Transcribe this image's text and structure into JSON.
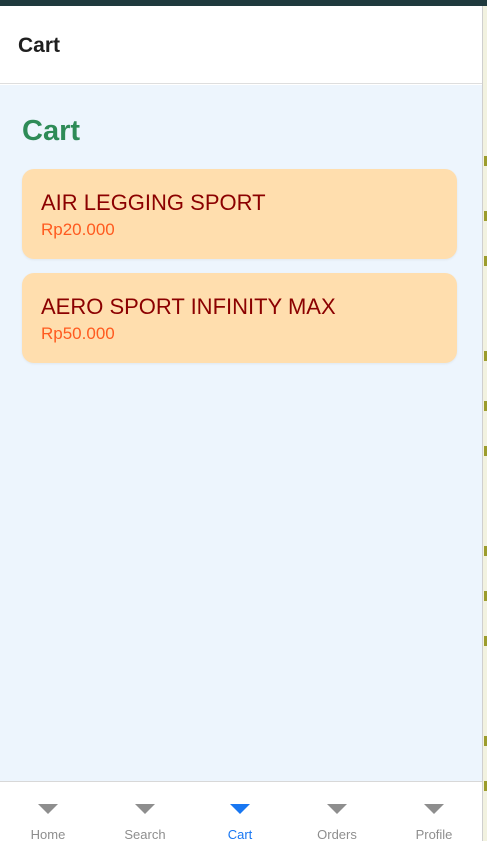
{
  "header": {
    "title": "Cart"
  },
  "page": {
    "heading": "Cart"
  },
  "cart": {
    "items": [
      {
        "name": "AIR LEGGING SPORT",
        "price": "Rp20.000"
      },
      {
        "name": "AERO SPORT INFINITY MAX",
        "price": "Rp50.000"
      }
    ]
  },
  "tabs": [
    {
      "label": "Home",
      "icon": "chevron-down-icon",
      "active": false
    },
    {
      "label": "Search",
      "icon": "chevron-down-icon",
      "active": false
    },
    {
      "label": "Cart",
      "icon": "chevron-down-icon",
      "active": true
    },
    {
      "label": "Orders",
      "icon": "chevron-down-icon",
      "active": false
    },
    {
      "label": "Profile",
      "icon": "chevron-down-icon",
      "active": false
    }
  ],
  "colors": {
    "heading": "#2e8b57",
    "item_bg": "#ffdeae",
    "item_name": "#8b0000",
    "item_price": "#ff5a1f",
    "active_tab": "#1877f2",
    "inactive_tab": "#8e8e8e",
    "content_bg": "#edf5fd"
  }
}
